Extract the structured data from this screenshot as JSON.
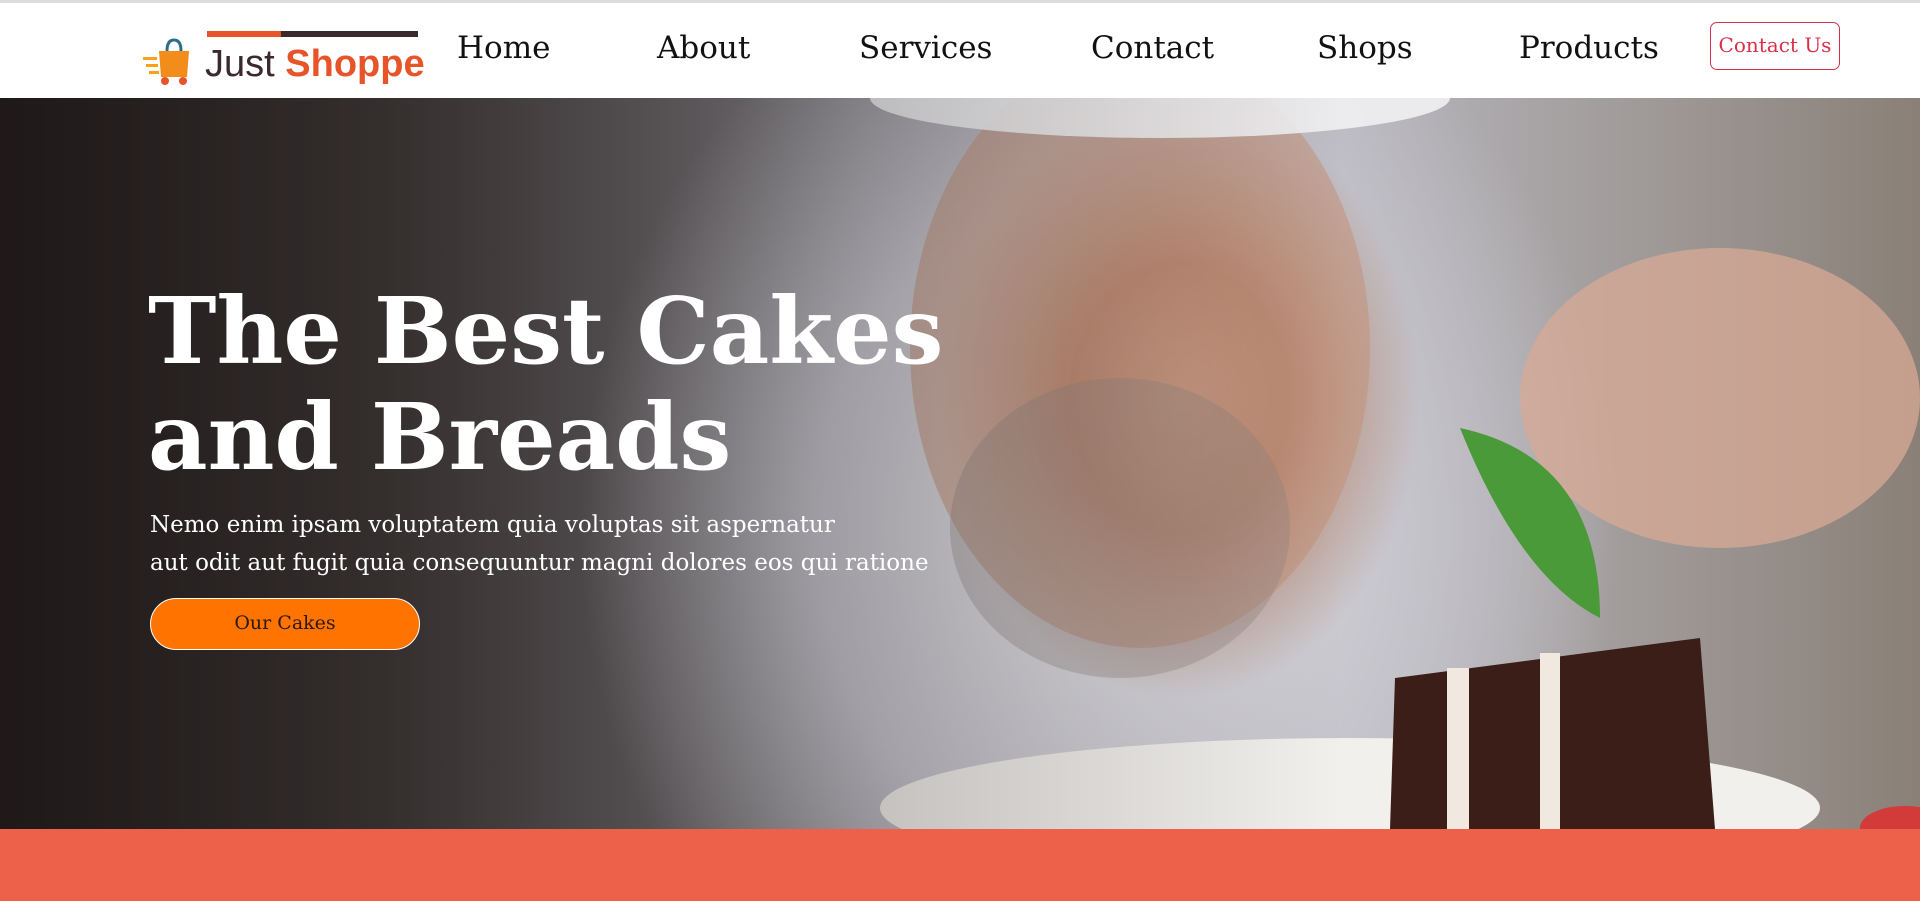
{
  "brand": {
    "logo_text_1": "Just",
    "logo_text_2": "Shoppe",
    "logo_icon": "shopping-bag-delivery-icon"
  },
  "nav": {
    "items": [
      {
        "label": "Home"
      },
      {
        "label": "About"
      },
      {
        "label": "Services"
      },
      {
        "label": "Contact"
      },
      {
        "label": "Shops"
      },
      {
        "label": "Products"
      }
    ],
    "cta_label": "Contact Us"
  },
  "hero": {
    "title": "The Best Cakes and Breads",
    "subtitle_line_1": "Nemo enim ipsam voluptatem quia voluptas sit aspernatur",
    "subtitle_line_2": "aut odit aut fugit quia consequuntur magni dolores eos qui ratione",
    "button_label": "Our Cakes",
    "image": "chef-garnishing-cake-photo"
  },
  "colors": {
    "accent_orange": "#ff7400",
    "brand_orange": "#e8542a",
    "contact_red": "#d9304a",
    "band_coral": "#ed604a",
    "logo_dark": "#3a2a2e"
  }
}
